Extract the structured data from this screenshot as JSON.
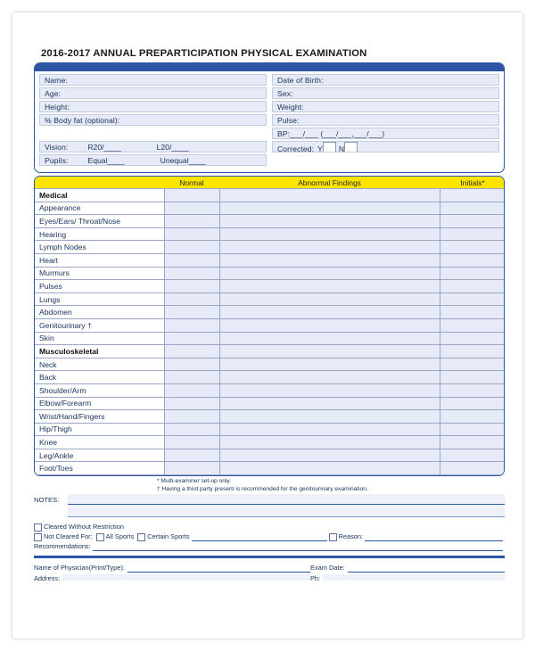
{
  "document": {
    "title": "2016-2017 ANNUAL PREPARTICIPATION PHYSICAL EXAMINATION"
  },
  "colors": {
    "header_blue": "#2c55a3",
    "band_yellow": "#ffe400",
    "field_fill": "#e7ebf7",
    "text_blue": "#16325c"
  },
  "identity": {
    "rows": [
      {
        "left_label": "Name:",
        "right_label": "Date of Birth:"
      },
      {
        "left_label": "Age:",
        "right_label": "Sex:"
      },
      {
        "left_label": "Height:",
        "right_label": "Weight:"
      },
      {
        "left_label": "% Body fat (optional):",
        "right_label": "Pulse:"
      }
    ],
    "bp_label": "BP:___/___ (___/___,___/___)",
    "corrected_label": "Corrected:",
    "corrected_yes": "Y",
    "corrected_no": "N",
    "vision_label": "Vision:",
    "vision_right": "R20/____",
    "vision_left": "L20/____",
    "pupils_label": "Pupils:",
    "pupils_equal": "Equal____",
    "pupils_unequal": "Unequal____"
  },
  "exam_table": {
    "headers": {
      "col1": "",
      "col2": "Normal",
      "col3": "Abnormal Findings",
      "col4": "Initials*"
    },
    "rows": [
      {
        "label": "Medical",
        "type": "section"
      },
      {
        "label": "Appearance",
        "type": "item"
      },
      {
        "label": "Eyes/Ears/ Throat/Nose",
        "type": "item"
      },
      {
        "label": "Hearing",
        "type": "item"
      },
      {
        "label": "Lymph Nodes",
        "type": "item"
      },
      {
        "label": "Heart",
        "type": "item"
      },
      {
        "label": "Murmurs",
        "type": "item"
      },
      {
        "label": "Pulses",
        "type": "item"
      },
      {
        "label": "Lungs",
        "type": "item"
      },
      {
        "label": "Abdomen",
        "type": "item"
      },
      {
        "label": "Genitourinary †",
        "type": "item"
      },
      {
        "label": "Skin",
        "type": "item"
      },
      {
        "label": "Musculoskeletal",
        "type": "section"
      },
      {
        "label": "Neck",
        "type": "item"
      },
      {
        "label": "Back",
        "type": "item"
      },
      {
        "label": "Shoulder/Arm",
        "type": "item"
      },
      {
        "label": "Elbow/Forearm",
        "type": "item"
      },
      {
        "label": "Wrist/Hand/Fingers",
        "type": "item"
      },
      {
        "label": "Hip/Thigh",
        "type": "item"
      },
      {
        "label": "Knee",
        "type": "item"
      },
      {
        "label": "Leg/Ankle",
        "type": "item"
      },
      {
        "label": "Foot/Toes",
        "type": "item"
      }
    ]
  },
  "footnotes": {
    "asterisk": "* Multi-examiner set-up only.",
    "dagger": "† Having a third party present is recommended for the genitourinary examination."
  },
  "notes": {
    "label": "NOTES:"
  },
  "clearance": {
    "cleared_without_restriction": "Cleared Without Restriction",
    "not_cleared_for": "Not Cleared For:",
    "all_sports": "All Sports",
    "certain_sports": "Certain Sports",
    "reason": "Reason:",
    "recommendations": "Recommendations:"
  },
  "physician": {
    "name_label": "Name of Physician(Print/Type):",
    "exam_date_label": "Exam Date:",
    "address_label": "Address:",
    "phone_label": "Ph:"
  }
}
